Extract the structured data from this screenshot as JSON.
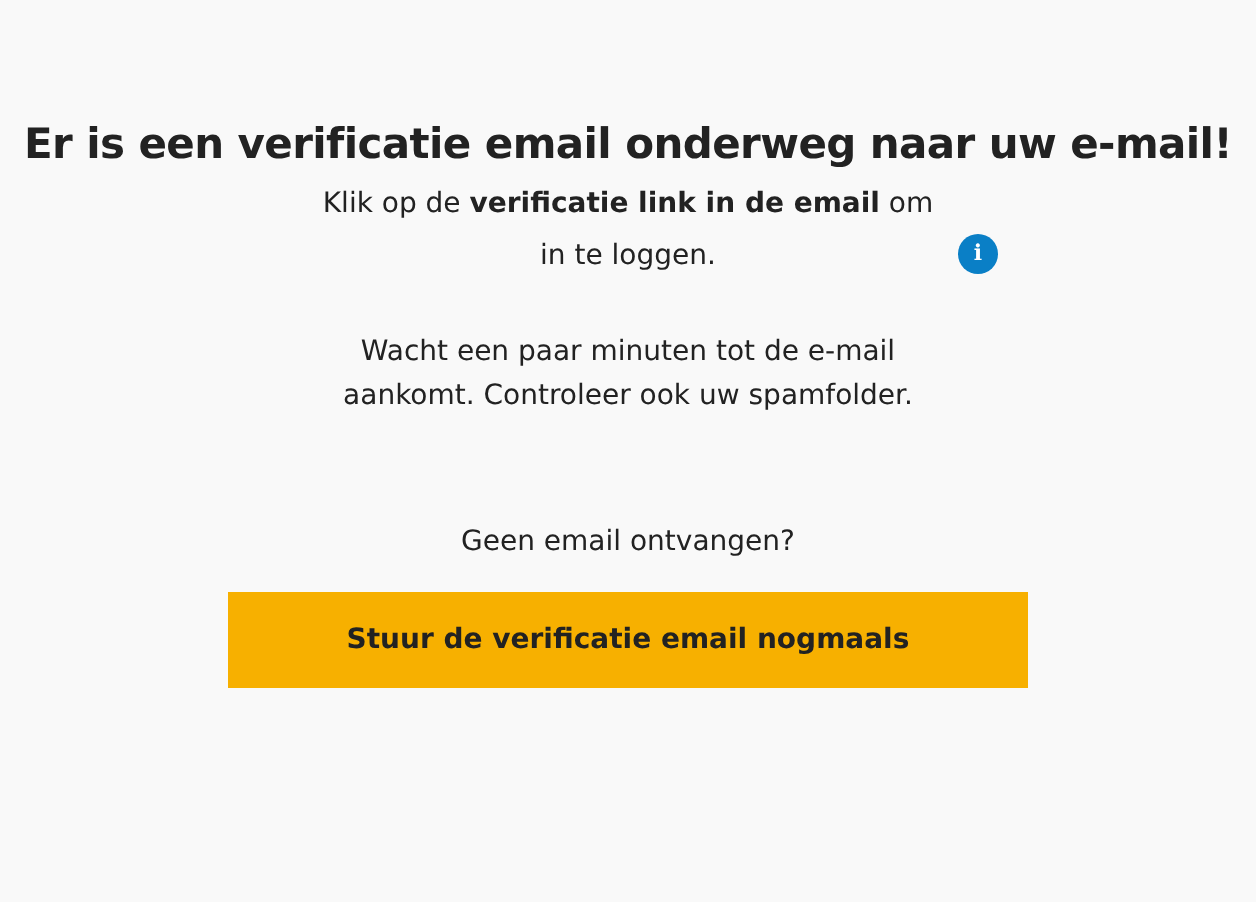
{
  "heading": "Er is een verificatie email onderweg naar uw e-mail!",
  "instruction": "Klik op de **verificatie link in de email** om in te loggen.",
  "info_icon": {
    "label": "i"
  },
  "wait_note": "Wacht een paar minuten tot de e-mail aankomt. Controleer ook uw spamfolder.",
  "no_email_prompt": "Geen email ontvangen?",
  "resend_button": "Stuur de verificatie email nogmaals"
}
